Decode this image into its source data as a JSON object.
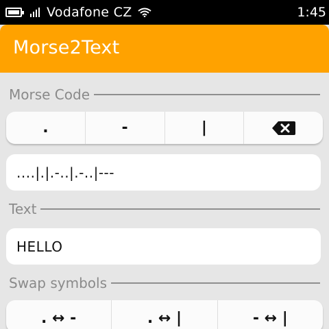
{
  "status_bar": {
    "carrier": "Vodafone CZ",
    "time": "1:45",
    "icons": [
      "battery-icon",
      "signal-icon",
      "wifi-icon"
    ]
  },
  "app": {
    "title": "Morse2Text",
    "accent_color": "#ffa200"
  },
  "morse_section": {
    "label": "Morse Code",
    "keys": [
      {
        "label": "."
      },
      {
        "label": "-"
      },
      {
        "label": "|"
      },
      {
        "label": "",
        "icon": "backspace-icon"
      }
    ],
    "value": "....|.|.-..|.-..|---"
  },
  "text_section": {
    "label": "Text",
    "value": "HELLO"
  },
  "swap_section": {
    "label": "Swap symbols",
    "buttons": [
      {
        "label": ". ↔ -"
      },
      {
        "label": ". ↔ |"
      },
      {
        "label": "- ↔ |"
      }
    ]
  }
}
